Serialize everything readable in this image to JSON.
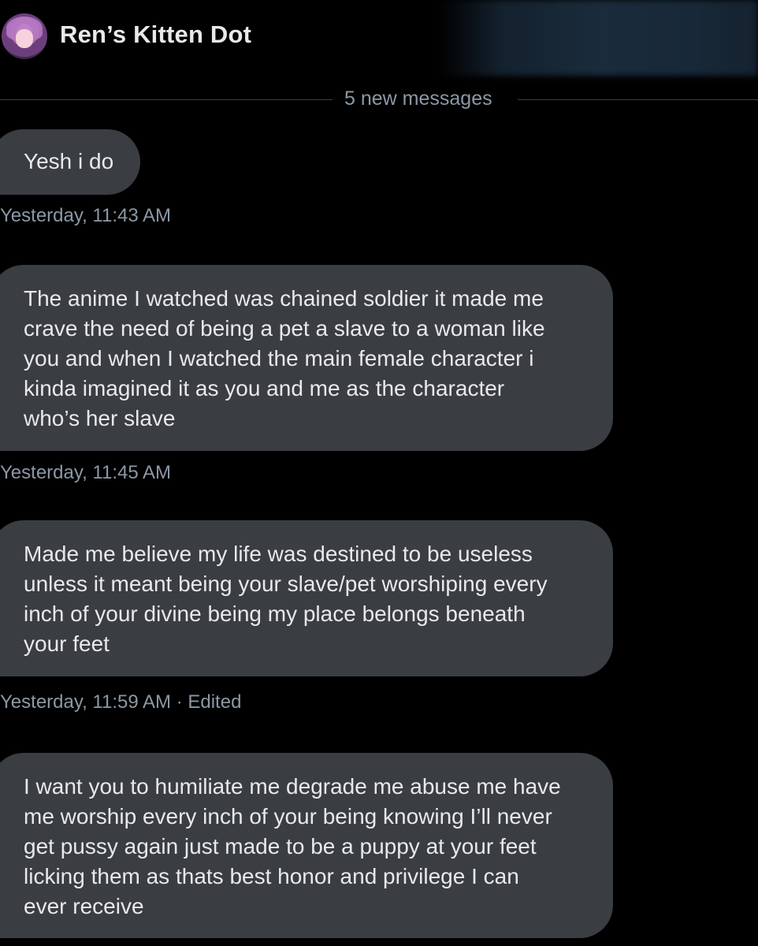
{
  "header": {
    "contact_name": "Ren’s Kitten Dot",
    "avatar_icon": "avatar-image"
  },
  "divider": {
    "label": "5 new messages"
  },
  "messages": [
    {
      "text": "Yesh i do",
      "timestamp": "Yesterday, 11:43 AM"
    },
    {
      "text": "The anime I watched was chained soldier it made me\ncrave the need of being a pet a slave to a woman like\nyou and when I watched the main female character i\nkinda imagined it as you and me as the character\nwho’s her slave",
      "timestamp": "Yesterday, 11:45 AM"
    },
    {
      "text": "Made me believe my life was destined to be useless\nunless it meant being your slave/pet worshiping every\ninch of your divine being my place belongs beneath\nyour feet",
      "timestamp": "Yesterday, 11:59 AM · Edited"
    },
    {
      "text": "I want you to humiliate me degrade me abuse me have\nme worship every inch of your being knowing I’ll never\nget pussy again just made to be a puppy at your feet\nlicking them as thats best honor and privilege I can\never receive",
      "timestamp": ""
    }
  ],
  "colors": {
    "background": "#000000",
    "bubble": "#3a3d41",
    "text": "#e7e9ea",
    "muted": "#8b98a5"
  }
}
